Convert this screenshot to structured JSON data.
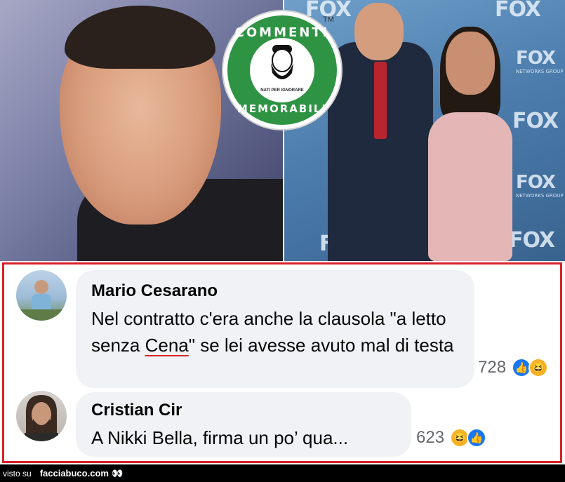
{
  "header_image": {
    "badge": {
      "top_text": "COMMENTI",
      "bottom_text": "MEMORABILI",
      "sub_text": "NATI PER IGNORARE",
      "tm": "TM"
    },
    "backdrop_logo": "FOX",
    "backdrop_sub": "NETWORKS GROUP"
  },
  "comments": [
    {
      "author": "Mario Cesarano",
      "text_before": "Nel contratto c'era anche la clausola \"a letto senza ",
      "text_underlined": "Cena",
      "text_after": "\" se lei avesse avuto mal di testa",
      "reaction_count": "728"
    },
    {
      "author": "Cristian Cir",
      "text": "A Nikki Bella, firma un po’ qua...",
      "reaction_count": "623"
    }
  ],
  "footer": {
    "prefix": "visto su",
    "site": "facciabuco.com",
    "eyes": "👀"
  },
  "colors": {
    "frame": "#d7222a",
    "bubble": "#f0f2f5",
    "badge_green": "#2e9443",
    "like_blue": "#1877f2",
    "haha_yellow": "#f7b125"
  }
}
